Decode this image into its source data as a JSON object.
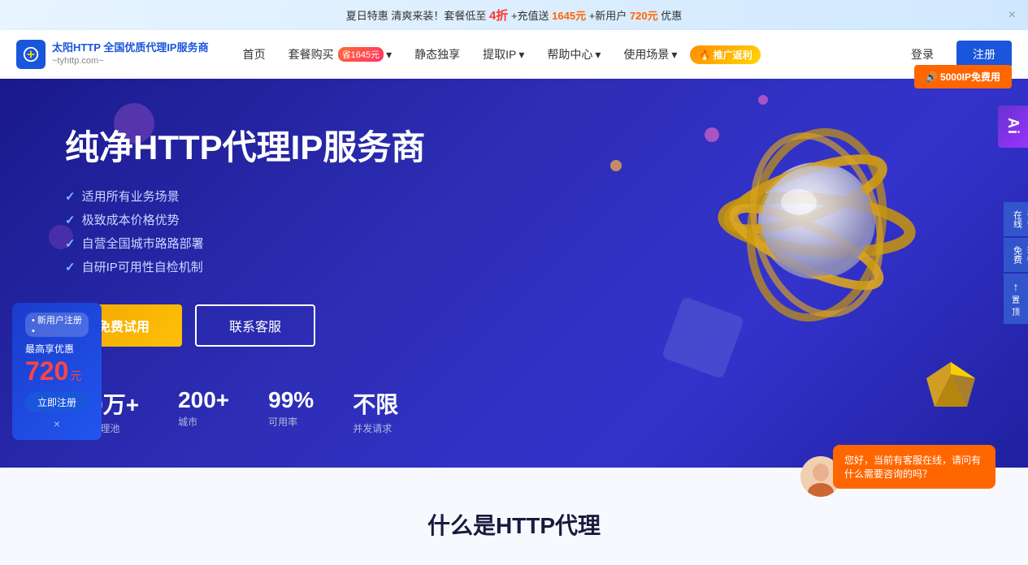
{
  "banner": {
    "text_pre": "夏日特惠 清爽来装！套餐低至",
    "discount": "4折",
    "text_mid": " +充值送",
    "amount1": "1645元",
    "text_post": " +新用户",
    "amount2": "720元",
    "text_end": " 优惠",
    "close": "×"
  },
  "nav": {
    "logo_main": "太阳HTTP 全国优质代理IP服务商",
    "logo_sub": "~tyhttp.com~",
    "links": [
      {
        "label": "首页",
        "has_arrow": false
      },
      {
        "label": "套餐购买",
        "badge": "省1645元",
        "has_arrow": true
      },
      {
        "label": "静态独享",
        "has_arrow": false
      },
      {
        "label": "提取IP",
        "has_arrow": true
      },
      {
        "label": "帮助中心",
        "has_arrow": true
      },
      {
        "label": "使用场景",
        "has_arrow": true
      }
    ],
    "promo": "🔥 推广返利",
    "login": "登录",
    "register": "注册"
  },
  "float_badge": "🔊 5000IP免费用",
  "hero": {
    "title": "纯净HTTP代理IP服务商",
    "features": [
      "适用所有业务场景",
      "极致成本价格优势",
      "自营全国城市路路部署",
      "自研IP可用性自检机制"
    ],
    "btn_trial": "免费试用",
    "btn_contact": "联系客服",
    "stats": [
      {
        "number": "900万+",
        "label": "HTTP代理池"
      },
      {
        "number": "200+",
        "label": "城市"
      },
      {
        "number": "99%",
        "label": "可用率"
      },
      {
        "number": "不限",
        "label": "并发请求"
      }
    ]
  },
  "side_panel": {
    "consult": "在线\n咨询",
    "free_package": "免费\n套餐",
    "top": "置顶"
  },
  "new_user": {
    "badge": "• 新用户注册 •",
    "label": "最高享优惠",
    "amount": "720",
    "unit": "元",
    "btn": "立即注册",
    "close": "×"
  },
  "what_section": {
    "title": "什么是HTTP代理"
  },
  "chat": {
    "bubble": "您好，当前有客服在线，请问有什么需要咨询的吗？"
  },
  "ai_badge": "Ai"
}
